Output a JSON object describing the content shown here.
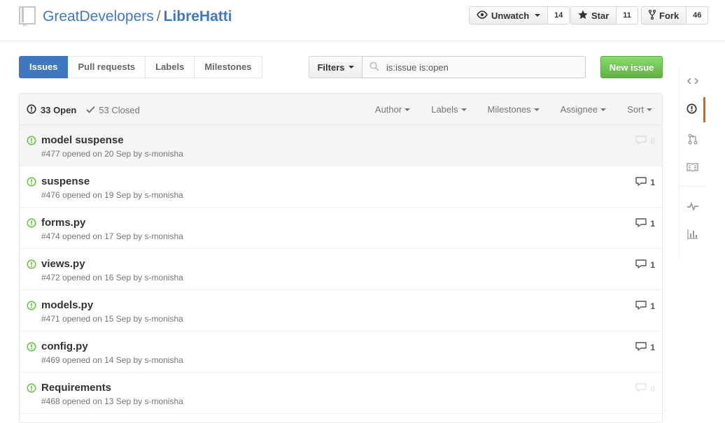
{
  "repo": {
    "owner": "GreatDevelopers",
    "separator": "/",
    "name": "LibreHatti"
  },
  "actions": [
    {
      "label": "Unwatch",
      "count": "14",
      "icon": "eye-icon"
    },
    {
      "label": "Star",
      "count": "11",
      "icon": "star-icon"
    },
    {
      "label": "Fork",
      "count": "46",
      "icon": "fork-icon"
    }
  ],
  "subnav": {
    "issues": "Issues",
    "pulls": "Pull requests",
    "labels": "Labels",
    "milestones": "Milestones"
  },
  "filters": {
    "button": "Filters",
    "query": "is:issue is:open"
  },
  "new_issue": "New issue",
  "states": {
    "open": "33 Open",
    "closed": "53 Closed"
  },
  "header_filters": {
    "author": "Author",
    "labels": "Labels",
    "milestones": "Milestones",
    "assignee": "Assignee",
    "sort": "Sort"
  },
  "issues": [
    {
      "title": "model suspense",
      "meta": "#477 opened on 20 Sep by s-monisha",
      "comments": "0"
    },
    {
      "title": "suspense",
      "meta": "#476 opened on 19 Sep by s-monisha",
      "comments": "1"
    },
    {
      "title": "forms.py",
      "meta": "#474 opened on 17 Sep by s-monisha",
      "comments": "1"
    },
    {
      "title": "views.py",
      "meta": "#472 opened on 16 Sep by s-monisha",
      "comments": "1"
    },
    {
      "title": "models.py",
      "meta": "#471 opened on 15 Sep by s-monisha",
      "comments": "1"
    },
    {
      "title": "config.py",
      "meta": "#469 opened on 14 Sep by s-monisha",
      "comments": "1"
    },
    {
      "title": "Requirements",
      "meta": "#468 opened on 13 Sep by s-monisha",
      "comments": "0"
    }
  ],
  "colors": {
    "link": "#4078c0",
    "open": "#6cc644",
    "accent": "#d26911",
    "primary_button": "#60b044"
  }
}
